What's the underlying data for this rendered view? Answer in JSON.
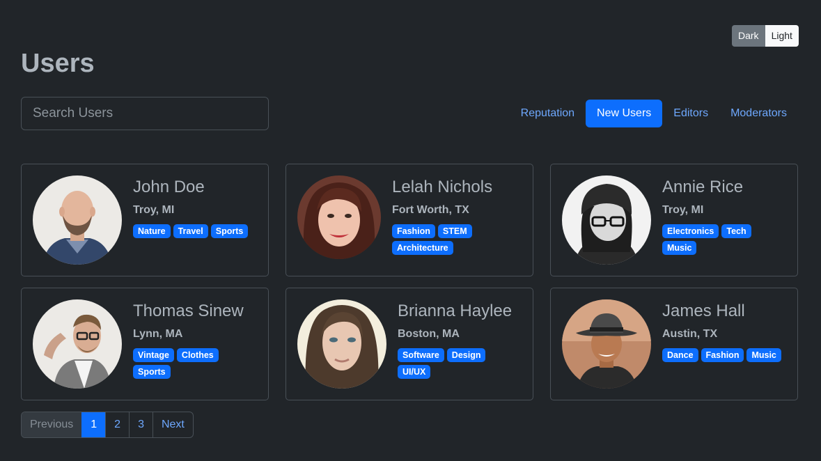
{
  "theme": {
    "dark_label": "Dark",
    "light_label": "Light"
  },
  "page": {
    "title": "Users"
  },
  "search": {
    "placeholder": "Search Users",
    "value": ""
  },
  "nav": {
    "items": [
      {
        "label": "Reputation",
        "active": false
      },
      {
        "label": "New Users",
        "active": true
      },
      {
        "label": "Editors",
        "active": false
      },
      {
        "label": "Moderators",
        "active": false
      }
    ]
  },
  "users": [
    {
      "name": "John Doe",
      "location": "Troy, MI",
      "tags": [
        "Nature",
        "Travel",
        "Sports"
      ],
      "avatar": "man-bald-beard-photo"
    },
    {
      "name": "Lelah Nichols",
      "location": "Fort Worth, TX",
      "tags": [
        "Fashion",
        "STEM",
        "Architecture"
      ],
      "avatar": "woman-brown-hair-photo"
    },
    {
      "name": "Annie Rice",
      "location": "Troy, MI",
      "tags": [
        "Electronics",
        "Tech",
        "Music"
      ],
      "avatar": "woman-beanie-glasses-photo"
    },
    {
      "name": "Thomas Sinew",
      "location": "Lynn, MA",
      "tags": [
        "Vintage",
        "Clothes",
        "Sports"
      ],
      "avatar": "man-glasses-cardigan-photo"
    },
    {
      "name": "Brianna Haylee",
      "location": "Boston, MA",
      "tags": [
        "Software",
        "Design",
        "UI/UX"
      ],
      "avatar": "woman-long-hair-photo"
    },
    {
      "name": "James Hall",
      "location": "Austin, TX",
      "tags": [
        "Dance",
        "Fashion",
        "Music"
      ],
      "avatar": "man-fedora-photo"
    }
  ],
  "pagination": {
    "previous": "Previous",
    "pages": [
      "1",
      "2",
      "3"
    ],
    "current": "1",
    "next": "Next"
  },
  "colors": {
    "background": "#212529",
    "accent": "#0d6efd",
    "link": "#6ea8fe",
    "border": "#495057"
  }
}
